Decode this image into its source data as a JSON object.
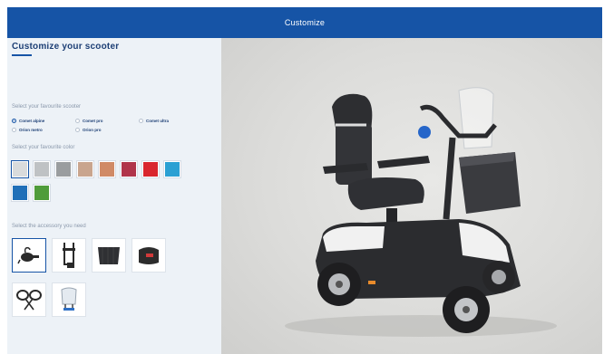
{
  "header": {
    "title": "Customize"
  },
  "sidebar": {
    "title": "Customize your scooter",
    "scooter_label": "Select your favourite scooter",
    "scooters": [
      {
        "label": "Comet alpine",
        "selected": true
      },
      {
        "label": "Comet pro",
        "selected": false
      },
      {
        "label": "Comet ultra",
        "selected": false
      },
      {
        "label": "Orion metro",
        "selected": false
      },
      {
        "label": "Orion pro",
        "selected": false
      }
    ],
    "color_label": "Select your favourite color",
    "colors": [
      {
        "name": "light-grey",
        "hex": "#d9dbdc",
        "selected": true
      },
      {
        "name": "silver",
        "hex": "#bfc2c4",
        "selected": false
      },
      {
        "name": "dark-grey",
        "hex": "#9a9d9f",
        "selected": false
      },
      {
        "name": "champagne",
        "hex": "#c9a58e",
        "selected": false
      },
      {
        "name": "copper",
        "hex": "#d08a66",
        "selected": false
      },
      {
        "name": "burgundy",
        "hex": "#b0344a",
        "selected": false
      },
      {
        "name": "red",
        "hex": "#d9262e",
        "selected": false
      },
      {
        "name": "sky-blue",
        "hex": "#2ba0d3",
        "selected": false
      },
      {
        "name": "blue",
        "hex": "#1f6fb8",
        "selected": false
      },
      {
        "name": "green",
        "hex": "#4f9c3a",
        "selected": false
      }
    ],
    "accessory_label": "Select the accessory you need",
    "accessories": [
      {
        "icon": "horn-icon",
        "selected": true
      },
      {
        "icon": "crutch-holder-icon",
        "selected": false
      },
      {
        "icon": "rear-basket-icon",
        "selected": false
      },
      {
        "icon": "bag-icon",
        "selected": false
      },
      {
        "icon": "mirrors-icon",
        "selected": false
      },
      {
        "icon": "windshield-icon",
        "selected": false
      }
    ]
  }
}
